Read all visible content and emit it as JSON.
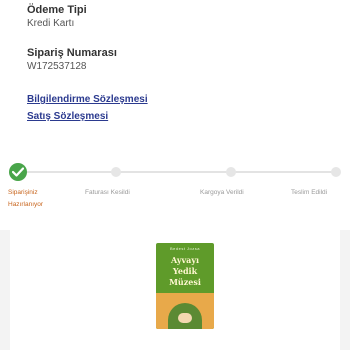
{
  "order": {
    "payment_type_label": "Ödeme Tipi",
    "payment_type_value": "Kredi Kartı",
    "order_number_label": "Sipariş Numarası",
    "order_number_value": "W172537128"
  },
  "links": {
    "info_agreement": "Bilgilendirme Sözleşmesi",
    "sales_agreement": "Satış Sözleşmesi"
  },
  "tracker": {
    "steps": [
      {
        "label_line1": "Siparişiniz",
        "label_line2": "Hazırlanıyor"
      },
      {
        "label_line1": "Faturası Kesildi"
      },
      {
        "label_line1": "Kargoya Verildi"
      },
      {
        "label_line1": "Teslim Edildi"
      }
    ]
  },
  "product": {
    "cover_brand": "Bedest Jozsa",
    "cover_title_1": "Ayvayı",
    "cover_title_2": "Yedik",
    "cover_title_3": "Müzesi"
  },
  "colors": {
    "accent_green": "#49a54a",
    "active_orange": "#c8651d",
    "link_blue": "#2b3a8f"
  },
  "icons": {
    "step_done": "check-icon"
  }
}
